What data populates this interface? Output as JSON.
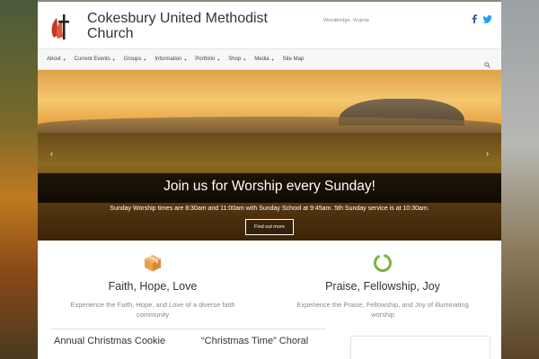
{
  "site": {
    "title": "Cokesbury United Methodist Church",
    "tagline": "Woodbridge, Virginia"
  },
  "social": [
    {
      "icon": "facebook-icon",
      "color": "#3b5998"
    },
    {
      "icon": "twitter-icon",
      "color": "#1da1f2"
    }
  ],
  "nav": {
    "items": [
      {
        "label": "About",
        "dropdown": true
      },
      {
        "label": "Current Events",
        "dropdown": true
      },
      {
        "label": "Groups",
        "dropdown": true
      },
      {
        "label": "Information",
        "dropdown": true
      },
      {
        "label": "Portfolio",
        "dropdown": true
      },
      {
        "label": "Shop",
        "dropdown": true
      },
      {
        "label": "Media",
        "dropdown": true
      },
      {
        "label": "Site Map",
        "dropdown": false
      }
    ],
    "search_icon": "search-icon"
  },
  "slider": {
    "title": "Join us for Worship every Sunday!",
    "text": "Sunday Worship times are 8:30am and 11:00am with Sunday School at 9:45am. 5th Sunday service is at 10:30am.",
    "button_label": "Find out more",
    "prev_arrow": "‹",
    "next_arrow": "›"
  },
  "features": [
    {
      "icon": "box-icon",
      "title": "Faith, Hope, Love",
      "desc": "Experience the Faith, Hope, and Love of a diverse faith community"
    },
    {
      "icon": "circle-ring-icon",
      "title": "Praise, Fellowship, Joy",
      "desc": "Experience the Praise, Fellowship, and Joy of illuminating worship"
    }
  ],
  "posts": [
    {
      "title": "Annual Christmas Cookie"
    },
    {
      "title": "“Christmas Time” Choral"
    }
  ],
  "colors": {
    "accent_orange": "#e8a04a",
    "accent_green": "#7cb342",
    "logo_red": "#c0392b"
  }
}
